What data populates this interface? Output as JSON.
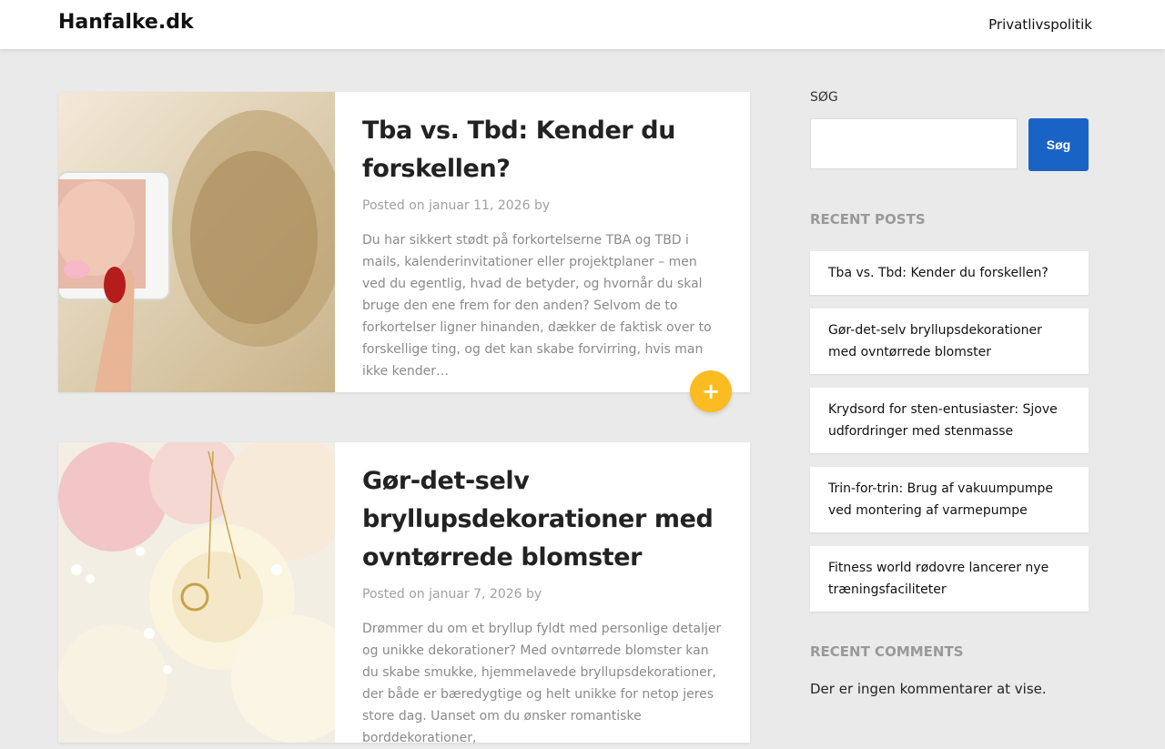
{
  "site": {
    "title": "Hanfalke.dk"
  },
  "nav": {
    "privacy": "Privatlivspolitik"
  },
  "posts": [
    {
      "title": "Tba vs. Tbd: Kender du forskellen?",
      "posted_on": "Posted on",
      "date": "januar 11, 2026",
      "by": "by",
      "excerpt": "Du har sikkert stødt på forkortelserne TBA og TBD i mails, kalenderinvitationer eller projektplaner – men ved du egentlig, hvad de betyder, og hvornår du skal bruge den ene frem for den anden? Selvom de to forkortelser ligner hinanden, dækker de faktisk over to forskellige ting, og det kan skabe forvirring, hvis man ikke kender…",
      "more": "+"
    },
    {
      "title": "Gør-det-selv bryllupsdekorationer med ovntørrede blomster",
      "posted_on": "Posted on",
      "date": "januar 7, 2026",
      "by": "by",
      "excerpt": "Drømmer du om et bryllup fyldt med personlige detaljer og unikke dekorationer? Med ovntørrede blomster kan du skabe smukke, hjemmelavede bryllupsdekorationer, der både er bæredygtige og helt unikke for netop jeres store dag. Uanset om du ønsker romantiske borddekorationer,"
    }
  ],
  "sidebar": {
    "search_label": "SØG",
    "search_button": "Søg",
    "recent_posts_title": "RECENT POSTS",
    "recent_posts": [
      "Tba vs. Tbd: Kender du forskellen?",
      "Gør-det-selv bryllupsdekorationer med ovntørrede blomster",
      "Krydsord for sten-entusiaster: Sjove udfordringer med stenmasse",
      "Trin-for-trin: Brug af vakuumpumpe ved montering af varmepumpe",
      "Fitness world rødovre lancerer nye træningsfaciliteter"
    ],
    "recent_comments_title": "RECENT COMMENTS",
    "no_comments": "Der er ingen kommentarer at vise."
  },
  "colors": {
    "accent": "#fbbc22",
    "button": "#1a63c6",
    "background": "#eaeaea"
  }
}
